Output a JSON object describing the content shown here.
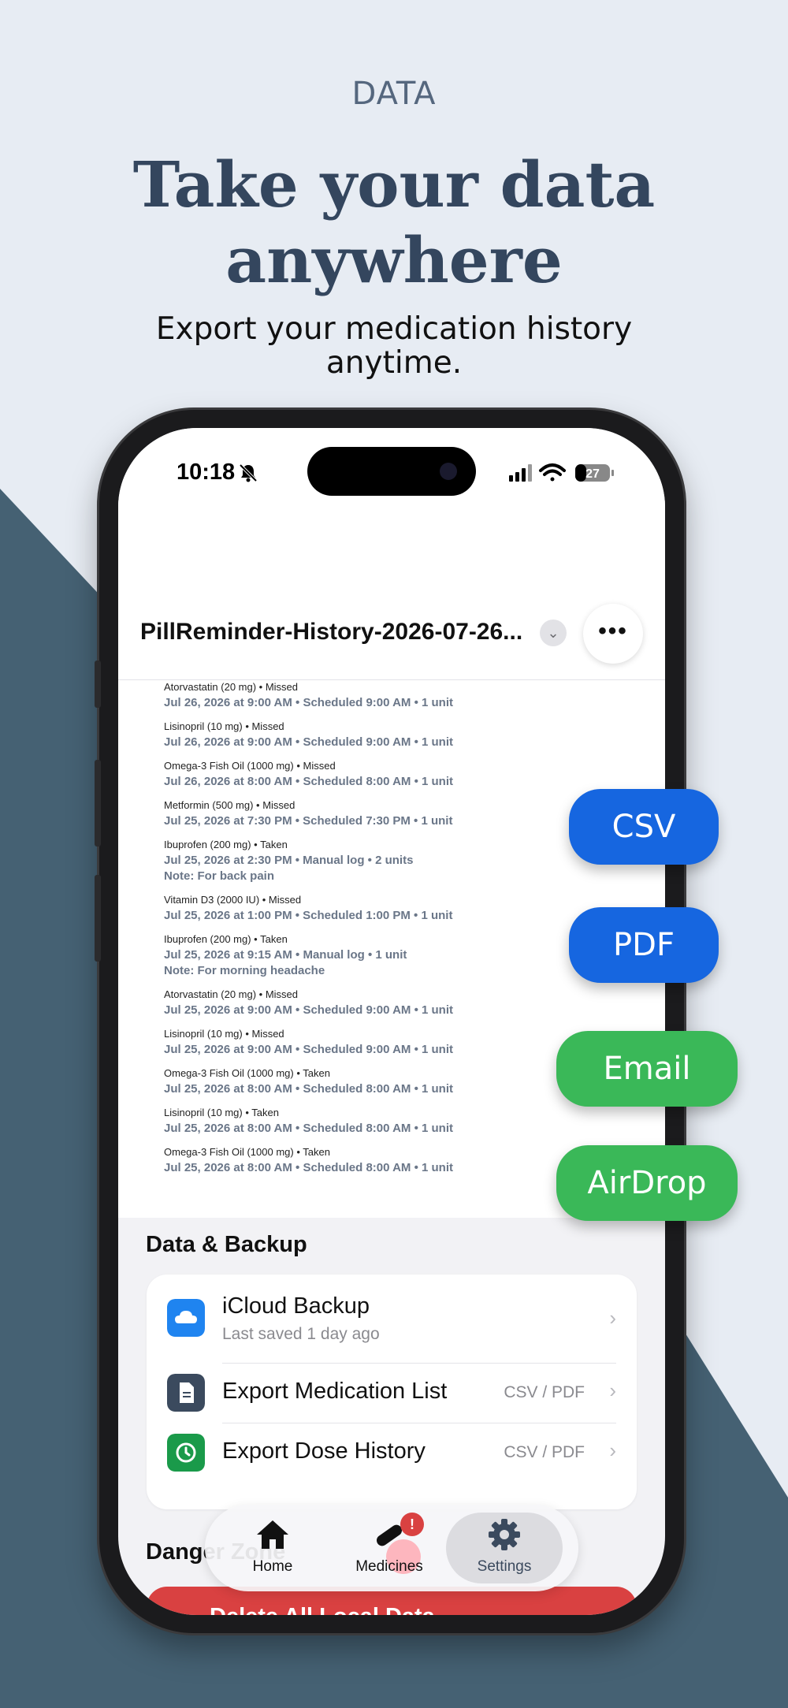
{
  "hero": {
    "eyebrow": "DATA",
    "title_line1": "Take your data",
    "title_line2": "anywhere",
    "subtitle_line1": "Export your medication history",
    "subtitle_line2": "anytime."
  },
  "status_bar": {
    "time": "10:18",
    "battery": "27"
  },
  "file": {
    "title": "PillReminder-History-2026-07-26..."
  },
  "log_entries": [
    {
      "title": "Atorvastatin (20 mg) • Missed",
      "detail": "Jul 26, 2026 at 9:00 AM • Scheduled 9:00 AM • 1 unit",
      "note": ""
    },
    {
      "title": "Lisinopril (10 mg) • Missed",
      "detail": "Jul 26, 2026 at 9:00 AM • Scheduled 9:00 AM • 1 unit",
      "note": ""
    },
    {
      "title": "Omega-3 Fish Oil (1000 mg) • Missed",
      "detail": "Jul 26, 2026 at 8:00 AM • Scheduled 8:00 AM • 1 unit",
      "note": ""
    },
    {
      "title": "Metformin (500 mg) • Missed",
      "detail": "Jul 25, 2026 at 7:30 PM • Scheduled 7:30 PM • 1 unit",
      "note": ""
    },
    {
      "title": "Ibuprofen (200 mg) • Taken",
      "detail": "Jul 25, 2026 at 2:30 PM • Manual log • 2 units",
      "note": "Note: For back pain"
    },
    {
      "title": "Vitamin D3 (2000 IU) • Missed",
      "detail": "Jul 25, 2026 at 1:00 PM • Scheduled 1:00 PM • 1 unit",
      "note": ""
    },
    {
      "title": "Ibuprofen (200 mg) • Taken",
      "detail": "Jul 25, 2026 at 9:15 AM • Manual log • 1 unit",
      "note": "Note: For morning headache"
    },
    {
      "title": "Atorvastatin (20 mg) • Missed",
      "detail": "Jul 25, 2026 at 9:00 AM • Scheduled 9:00 AM • 1 unit",
      "note": ""
    },
    {
      "title": "Lisinopril (10 mg) • Missed",
      "detail": "Jul 25, 2026 at 9:00 AM • Scheduled 9:00 AM • 1 unit",
      "note": ""
    },
    {
      "title": "Omega-3 Fish Oil (1000 mg) • Taken",
      "detail": "Jul 25, 2026 at 8:00 AM • Scheduled 8:00 AM • 1 unit",
      "note": ""
    },
    {
      "title": "Lisinopril (10 mg) • Taken",
      "detail": "Jul 25, 2026 at 8:00 AM • Scheduled 8:00 AM • 1 unit",
      "note": ""
    },
    {
      "title": "Omega-3 Fish Oil (1000 mg) • Taken",
      "detail": "Jul 25, 2026 at 8:00 AM • Scheduled 8:00 AM • 1 unit",
      "note": ""
    }
  ],
  "data_backup": {
    "section_title": "Data & Backup",
    "icloud_label": "iCloud Backup",
    "icloud_sub": "Last saved 1 day ago",
    "export_meds_label": "Export Medication List",
    "export_meds_value": "CSV / PDF",
    "export_history_label": "Export Dose History",
    "export_history_value": "CSV / PDF"
  },
  "danger": {
    "section_title": "Danger Zone",
    "delete_label": "Delete All Local Data"
  },
  "tabs": {
    "home": "Home",
    "medicines": "Medicines",
    "settings": "Settings",
    "badge": "!"
  },
  "export_options": {
    "csv": "CSV",
    "pdf": "PDF",
    "email": "Email",
    "airdrop": "AirDrop"
  },
  "colors": {
    "background": "#e7ecf3",
    "dark_slate": "#456173",
    "heading": "#34465e",
    "blue": "#1666e0",
    "green": "#3ab858",
    "danger_red": "#d94141"
  }
}
